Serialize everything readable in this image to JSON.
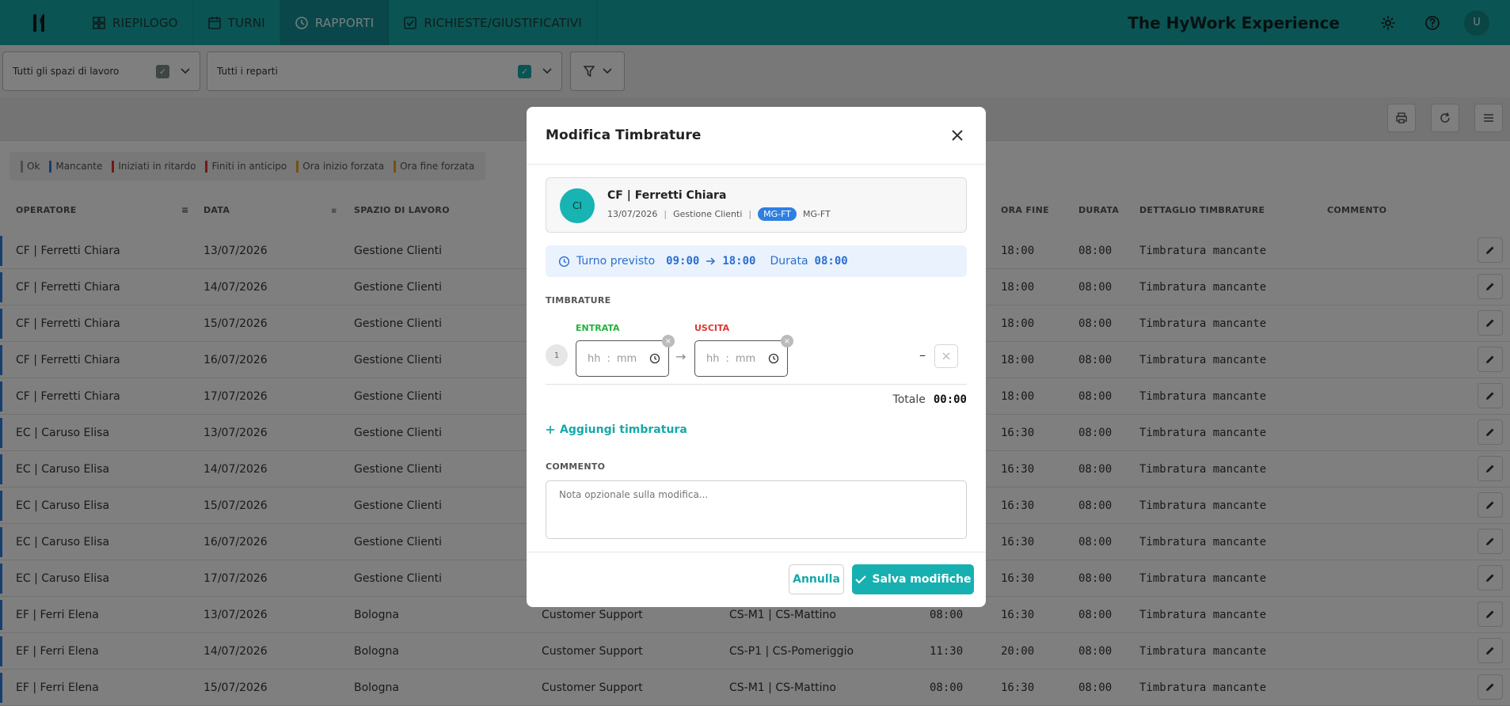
{
  "topbar": {
    "logo": "H",
    "nav": [
      {
        "label": "RIEPILOGO",
        "icon": "dashboard-icon"
      },
      {
        "label": "TURNI",
        "icon": "calendar-icon"
      },
      {
        "label": "RAPPORTI",
        "icon": "clock-icon",
        "active": true
      },
      {
        "label": "RICHIESTE/GIUSTIFICATIVI",
        "icon": "checkbox-icon"
      }
    ],
    "brand": "The HyWork Experience",
    "avatar": "U"
  },
  "filters": {
    "spazi": "Tutti gli spazi di lavoro",
    "reparti": "Tutti i reparti"
  },
  "legend": [
    {
      "label": "Ok",
      "color": "#9e9e9e"
    },
    {
      "label": "Mancante",
      "color": "#2f7fe0"
    },
    {
      "label": "Iniziati in ritardo",
      "color": "#e0362e"
    },
    {
      "label": "Finiti in anticipo",
      "color": "#e0362e"
    },
    {
      "label": "Ora inizio forzata",
      "color": "#f0a020"
    },
    {
      "label": "Ora fine forzata",
      "color": "#f0a020"
    }
  ],
  "table": {
    "headers": {
      "operatore": "OPERATORE",
      "data": "DATA",
      "spazio": "SPAZIO DI LAVORO",
      "ora_fine": "ORA FINE",
      "durata": "DURATA",
      "dettaglio": "DETTAGLIO TIMBRATURE",
      "commento": "COMMENTO"
    },
    "rows": [
      {
        "operatore": "CF | Ferretti Chiara",
        "data": "13/07/2026",
        "spazio": "Gestione Clienti",
        "reparto": "",
        "turno": "",
        "ora_inizio": "",
        "ora_fine": "18:00",
        "durata": "08:00",
        "dettaglio": "Timbratura mancante"
      },
      {
        "operatore": "CF | Ferretti Chiara",
        "data": "14/07/2026",
        "spazio": "Gestione Clienti",
        "reparto": "",
        "turno": "",
        "ora_inizio": "",
        "ora_fine": "18:00",
        "durata": "08:00",
        "dettaglio": "Timbratura mancante"
      },
      {
        "operatore": "CF | Ferretti Chiara",
        "data": "15/07/2026",
        "spazio": "Gestione Clienti",
        "reparto": "",
        "turno": "",
        "ora_inizio": "",
        "ora_fine": "18:00",
        "durata": "08:00",
        "dettaglio": "Timbratura mancante"
      },
      {
        "operatore": "CF | Ferretti Chiara",
        "data": "16/07/2026",
        "spazio": "Gestione Clienti",
        "reparto": "",
        "turno": "",
        "ora_inizio": "",
        "ora_fine": "18:00",
        "durata": "08:00",
        "dettaglio": "Timbratura mancante"
      },
      {
        "operatore": "CF | Ferretti Chiara",
        "data": "17/07/2026",
        "spazio": "Gestione Clienti",
        "reparto": "",
        "turno": "",
        "ora_inizio": "",
        "ora_fine": "18:00",
        "durata": "08:00",
        "dettaglio": "Timbratura mancante"
      },
      {
        "operatore": "EC | Caruso Elisa",
        "data": "13/07/2026",
        "spazio": "Gestione Clienti",
        "reparto": "",
        "turno": "",
        "ora_inizio": "",
        "ora_fine": "16:30",
        "durata": "08:00",
        "dettaglio": "Timbratura mancante"
      },
      {
        "operatore": "EC | Caruso Elisa",
        "data": "14/07/2026",
        "spazio": "Gestione Clienti",
        "reparto": "",
        "turno": "",
        "ora_inizio": "",
        "ora_fine": "16:30",
        "durata": "08:00",
        "dettaglio": "Timbratura mancante"
      },
      {
        "operatore": "EC | Caruso Elisa",
        "data": "15/07/2026",
        "spazio": "Gestione Clienti",
        "reparto": "",
        "turno": "",
        "ora_inizio": "",
        "ora_fine": "16:30",
        "durata": "08:00",
        "dettaglio": "Timbratura mancante"
      },
      {
        "operatore": "EC | Caruso Elisa",
        "data": "16/07/2026",
        "spazio": "Gestione Clienti",
        "reparto": "",
        "turno": "",
        "ora_inizio": "",
        "ora_fine": "16:30",
        "durata": "08:00",
        "dettaglio": "Timbratura mancante"
      },
      {
        "operatore": "EC | Caruso Elisa",
        "data": "17/07/2026",
        "spazio": "Gestione Clienti",
        "reparto": "",
        "turno": "",
        "ora_inizio": "",
        "ora_fine": "16:30",
        "durata": "08:00",
        "dettaglio": "Timbratura mancante"
      },
      {
        "operatore": "EF | Ferri Elena",
        "data": "13/07/2026",
        "spazio": "Bologna",
        "reparto": "Customer Support",
        "turno": "CS-M1 | CS-Mattino",
        "ora_inizio": "08:00",
        "ora_fine": "16:30",
        "durata": "08:00",
        "dettaglio": "Timbratura mancante"
      },
      {
        "operatore": "EF | Ferri Elena",
        "data": "14/07/2026",
        "spazio": "Bologna",
        "reparto": "Customer Support",
        "turno": "CS-P1 | CS-Pomeriggio",
        "ora_inizio": "11:30",
        "ora_fine": "20:00",
        "durata": "08:00",
        "dettaglio": "Timbratura mancante"
      },
      {
        "operatore": "EF | Ferri Elena",
        "data": "15/07/2026",
        "spazio": "Bologna",
        "reparto": "Customer Support",
        "turno": "CS-M1 | CS-Mattino",
        "ora_inizio": "08:00",
        "ora_fine": "16:30",
        "durata": "08:00",
        "dettaglio": "Timbratura mancante"
      }
    ]
  },
  "modal": {
    "title": "Modifica Timbrature",
    "operator": {
      "initials": "CI",
      "name": "CF | Ferretti Chiara",
      "date": "13/07/2026",
      "space": "Gestione Clienti",
      "badge": "MG-FT",
      "code": "MG-FT"
    },
    "turno": {
      "label": "Turno previsto",
      "start": "09:00",
      "end": "18:00",
      "durata_label": "Durata",
      "durata": "08:00"
    },
    "timbrature_label": "TIMBRATURE",
    "entrata_label": "ENTRATA",
    "uscita_label": "USCITA",
    "index": "1",
    "hh_placeholder": "hh",
    "mm_placeholder": "mm",
    "dash": "–",
    "totale_label": "Totale",
    "totale": "00:00",
    "add_label": "Aggiungi timbratura",
    "commento_label": "COMMENTO",
    "commento_placeholder": "Nota opzionale sulla modifica...",
    "cancel_label": "Annulla",
    "save_label": "Salva modifiche"
  },
  "colors": {
    "accent": "#17a8a8",
    "missing": "#2f7fe0",
    "entrata": "#22b33c",
    "uscita": "#e0362e"
  }
}
